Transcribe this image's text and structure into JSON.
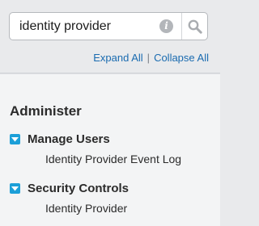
{
  "search": {
    "value": "identity provider"
  },
  "links": {
    "expand_all": "Expand All",
    "separator": "|",
    "collapse_all": "Collapse All"
  },
  "section": {
    "title": "Administer",
    "groups": [
      {
        "label": "Manage Users",
        "expanded": true,
        "items": [
          "Identity Provider Event Log"
        ]
      },
      {
        "label": "Security Controls",
        "expanded": true,
        "items": [
          "Identity Provider"
        ]
      }
    ]
  },
  "colors": {
    "accent": "#1c9fd8",
    "link": "#1a6bb0"
  }
}
